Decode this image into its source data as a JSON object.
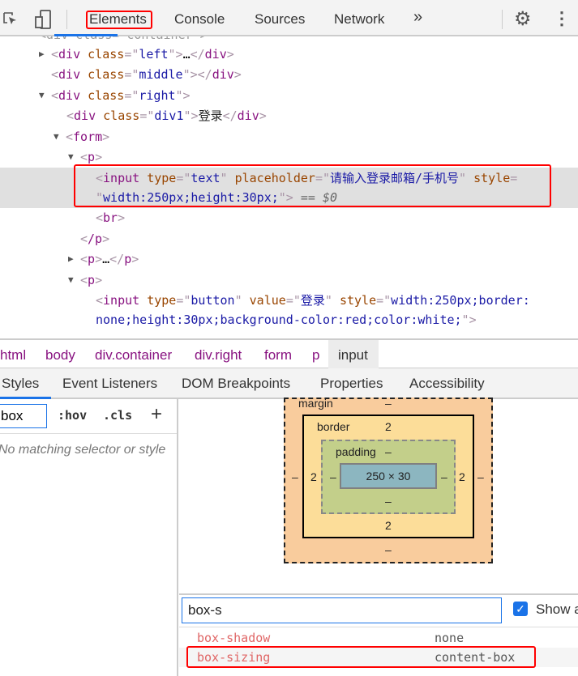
{
  "toolbar": {
    "tabs": [
      "Elements",
      "Console",
      "Sources",
      "Network"
    ],
    "more": "»",
    "active": "Elements"
  },
  "dom": {
    "partial_top": "<div class=\"container\">",
    "rows": [
      {
        "tag": "div",
        "attr": "class",
        "val": "left",
        "collapsed": true
      },
      {
        "tag": "div",
        "attr": "class",
        "val": "middle"
      },
      {
        "tag": "div",
        "attr": "class",
        "val": "right"
      },
      {
        "tag": "div",
        "attr": "class",
        "val": "div1",
        "text": "登录"
      },
      {
        "tag": "form"
      },
      {
        "tag": "p"
      }
    ],
    "selected": {
      "line1_type_attr": "type",
      "line1_type_val": "text",
      "placeholder_attr": "placeholder",
      "placeholder_val": "请输入登录邮箱/手机号",
      "style_attr": "style",
      "style_val": "width:250px;height:30px;",
      "marker": "== $0"
    },
    "br": "br",
    "p_close": "/p",
    "p_collapsed": "p",
    "p_open": "p",
    "button_input": {
      "type_val": "button",
      "value_attr": "value",
      "value_val": "登录",
      "style_attr": "style",
      "line1": "width:250px;border:",
      "line2": "none;height:30px;background-color:red;color:white;"
    }
  },
  "breadcrumbs": [
    "html",
    "body",
    "div.container",
    "div.right",
    "form",
    "p",
    "input"
  ],
  "subtabs": [
    "Styles",
    "Event Listeners",
    "DOM Breakpoints",
    "Properties",
    "Accessibility"
  ],
  "styles": {
    "filter_value": "box",
    "hov": ":hov",
    "cls": ".cls",
    "add": "+",
    "empty": "No matching selector or style"
  },
  "box_model": {
    "margin_label": "margin",
    "margin": "–",
    "border_label": "border",
    "border_top": "2",
    "border_left": "2",
    "border_right": "2",
    "border_bottom": "2",
    "padding_label": "padding",
    "padding": "–",
    "content": "250 × 30",
    "colors": {
      "margin": "#f9cc9d",
      "border": "#fcdd99",
      "padding": "#c3cf8a",
      "content": "#8cb6c0"
    }
  },
  "computed": {
    "filter_value": "box-s",
    "show_all_label": "Show all",
    "show_all_checked": true,
    "props": [
      {
        "name": "box-shadow",
        "value": "none"
      },
      {
        "name": "box-sizing",
        "value": "content-box"
      }
    ]
  }
}
